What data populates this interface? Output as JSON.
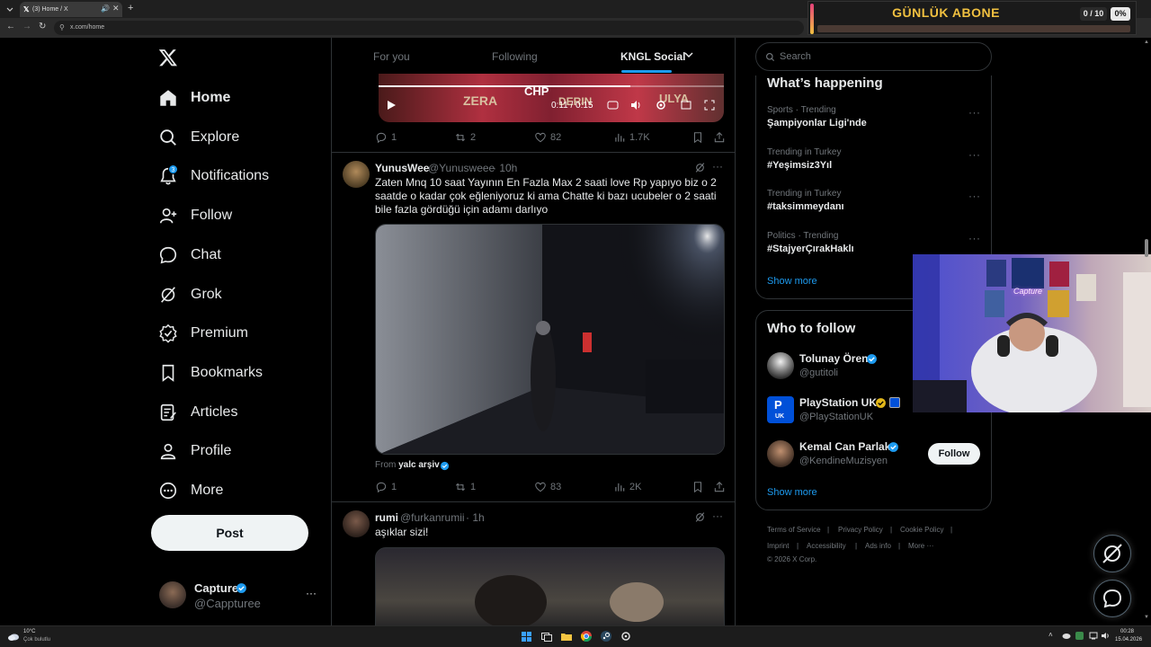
{
  "browser": {
    "tab_title": "(3) Home / X",
    "url": "x.com/home"
  },
  "overlay": {
    "title": "GÜNLÜK ABONE",
    "count": "0 / 10",
    "percent": "0%",
    "progress": 0
  },
  "nav": {
    "items": [
      {
        "label": "Home",
        "icon": "home-icon"
      },
      {
        "label": "Explore",
        "icon": "search-icon"
      },
      {
        "label": "Notifications",
        "icon": "bell-icon",
        "badge": "3"
      },
      {
        "label": "Follow",
        "icon": "person-add-icon"
      },
      {
        "label": "Chat",
        "icon": "chat-icon"
      },
      {
        "label": "Grok",
        "icon": "grok-icon"
      },
      {
        "label": "Premium",
        "icon": "verified-icon"
      },
      {
        "label": "Bookmarks",
        "icon": "bookmark-icon"
      },
      {
        "label": "Articles",
        "icon": "article-icon"
      },
      {
        "label": "Profile",
        "icon": "person-icon"
      },
      {
        "label": "More",
        "icon": "more-circle-icon"
      }
    ],
    "post_label": "Post"
  },
  "account": {
    "name": "Capture",
    "handle": "@Cappturee"
  },
  "feed": {
    "tabs": [
      "For you",
      "Following",
      "KNGL Social"
    ],
    "video1": {
      "time": "0:11 / 0:15",
      "sign_texts": [
        "ZERA",
        "CHP",
        "DERIN",
        "ULYA"
      ]
    },
    "post1_actions": {
      "replies": "1",
      "reposts": "2",
      "likes": "82",
      "views": "1.7K"
    },
    "post2": {
      "name": "YunusWee",
      "handle": "@Yunusweee",
      "time": "· 10h",
      "text": "Zaten Mnq 10 saat Yayının En Fazla Max 2 saati love Rp yapıyo biz o 2 saatde o kadar çok eğleniyoruz ki ama Chatte ki bazı ucubeler o 2 saati bile fazla gördüğü için adamı darlıyo",
      "from_label": "From",
      "from_name": "yalc arşiv",
      "actions": {
        "replies": "1",
        "reposts": "1",
        "likes": "83",
        "views": "2K"
      }
    },
    "post3": {
      "name": "rumi",
      "handle": "@furkanrumii",
      "time": "· 1h",
      "text": "aşıklar sizi!"
    }
  },
  "sidebar": {
    "search_placeholder": "Search",
    "happening_title": "What’s happening",
    "trends": [
      {
        "meta": "Sports · Trending",
        "name": "Şampiyonlar Ligi'nde"
      },
      {
        "meta": "Trending in Turkey",
        "name": "#Yeşimsiz3Yıl"
      },
      {
        "meta": "Trending in Turkey",
        "name": "#taksimmeydanı"
      },
      {
        "meta": "Politics · Trending",
        "name": "#StajyerÇırakHaklı"
      }
    ],
    "show_more": "Show more",
    "who_title": "Who to follow",
    "who": [
      {
        "name": "Tolunay Ören",
        "handle": "@gutitoli"
      },
      {
        "name": "PlayStation UK",
        "handle": "@PlayStationUK",
        "avatar_label": "UK"
      },
      {
        "name": "Kemal Can Parlak",
        "handle": "@KendineMuzisyen",
        "button": "Follow"
      }
    ],
    "who_show_more": "Show more",
    "footer": [
      "Terms of Service",
      "|",
      "Privacy Policy",
      "|",
      "Cookie Policy",
      "|",
      "Imprint",
      "|",
      "Accessibility",
      "|",
      "Ads info",
      "|",
      "More ···"
    ],
    "copyright": "© 2026 X Corp."
  },
  "webcam": {
    "sign": "Capture"
  },
  "taskbar": {
    "temp": "10°C",
    "weather": "Çok bulutlu",
    "time": "00:28",
    "date": "15.04.2026"
  },
  "colors": {
    "accent": "#1d9bf0",
    "overlay_gold": "#f0c040",
    "verified": "#1d9bf0",
    "gold_badge": "#e2b719"
  }
}
